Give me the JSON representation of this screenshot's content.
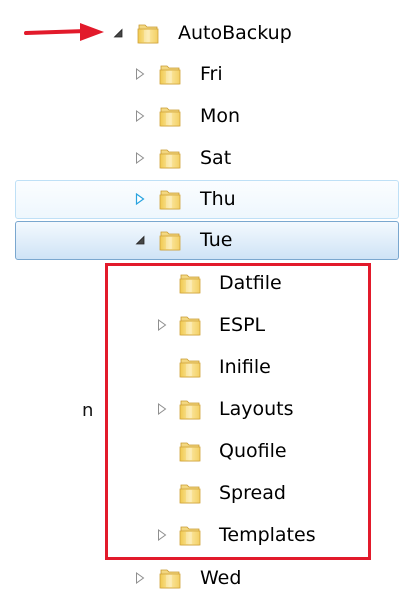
{
  "tree": {
    "root": {
      "label": "AutoBackup",
      "expanded": true
    },
    "children": [
      {
        "label": "Fri",
        "has_children": true,
        "state": "normal"
      },
      {
        "label": "Mon",
        "has_children": true,
        "state": "normal"
      },
      {
        "label": "Sat",
        "has_children": true,
        "state": "normal"
      },
      {
        "label": "Thu",
        "has_children": true,
        "state": "hover"
      },
      {
        "label": "Tue",
        "has_children": true,
        "state": "selected-expanded"
      },
      {
        "label": "Wed",
        "has_children": true,
        "state": "normal"
      }
    ],
    "tue_children": [
      {
        "label": "Datfile",
        "has_children": false
      },
      {
        "label": "ESPL",
        "has_children": true
      },
      {
        "label": "Inifile",
        "has_children": false
      },
      {
        "label": "Layouts",
        "has_children": true
      },
      {
        "label": "Quofile",
        "has_children": false
      },
      {
        "label": "Spread",
        "has_children": false
      },
      {
        "label": "Templates",
        "has_children": true
      }
    ]
  },
  "left_edge_fragment": "n",
  "colors": {
    "annotation_red": "#e21a2b",
    "selection_border": "#7aa7cf",
    "hover_border": "#bfe0f6",
    "folder_yellow": "#f3cf63"
  },
  "icons": {
    "folder": "folder-icon",
    "collapsed": "triangle-right-icon",
    "expanded": "triangle-down-icon",
    "pointer": "red-arrow-annotation"
  }
}
